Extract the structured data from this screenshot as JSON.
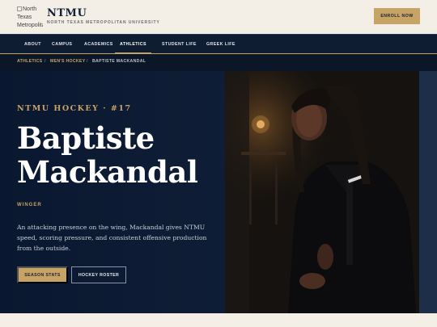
{
  "header": {
    "logo_alt": "North Texas Metropolitan",
    "brand_name": "NTMU",
    "brand_subtitle": "NORTH TEXAS METROPOLITAN UNIVERSITY",
    "enroll_label": "ENROLL NOW"
  },
  "nav": {
    "items": [
      {
        "label": "ABOUT"
      },
      {
        "label": "CAMPUS"
      },
      {
        "label": "ACADEMICS"
      },
      {
        "label": "ATHLETICS"
      },
      {
        "label": "STUDENT LIFE"
      },
      {
        "label": "GREEK LIFE"
      }
    ],
    "active": "ATHLETICS"
  },
  "breadcrumb": {
    "items": [
      "ATHLETICS",
      "MEN'S HOCKEY",
      "BAPTISTE MACKANDAL"
    ],
    "separator": "/"
  },
  "hero": {
    "eyebrow": "NTMU HOCKEY · #17",
    "name_line1": "Baptiste",
    "name_line2": "Mackandal",
    "position": "WINGER",
    "description": "An attacking presence on the wing, Mackandal gives NTMU speed, scoring pressure, and consistent offensive production from the outside.",
    "primary_button": "SEASON STATS",
    "secondary_button": "HOCKEY ROSTER"
  },
  "colors": {
    "navy": "#0f1d33",
    "gold": "#c7a466",
    "cream": "#f3efe6"
  }
}
